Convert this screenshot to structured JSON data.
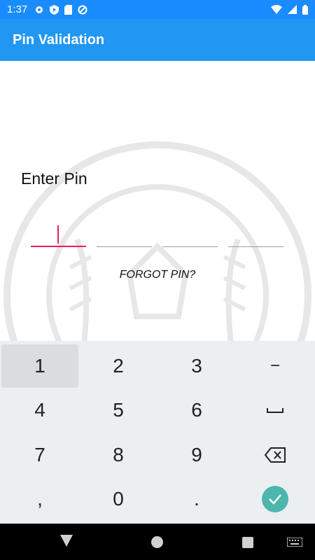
{
  "status_bar": {
    "time": "1:37"
  },
  "app_bar": {
    "title": "Pin Validation"
  },
  "pin": {
    "label": "Enter Pin",
    "forgot": "FORGOT PIN?"
  },
  "keyboard": {
    "keys": [
      "1",
      "2",
      "3",
      "−",
      "4",
      "5",
      "6",
      "␣",
      "7",
      "8",
      "9",
      "⌫",
      ",",
      "0",
      ".",
      "✓"
    ]
  },
  "colors": {
    "primary": "#2196f3",
    "status_bar": "#1a8cff",
    "accent": "#e91e63",
    "enter_key": "#4db6ac"
  }
}
